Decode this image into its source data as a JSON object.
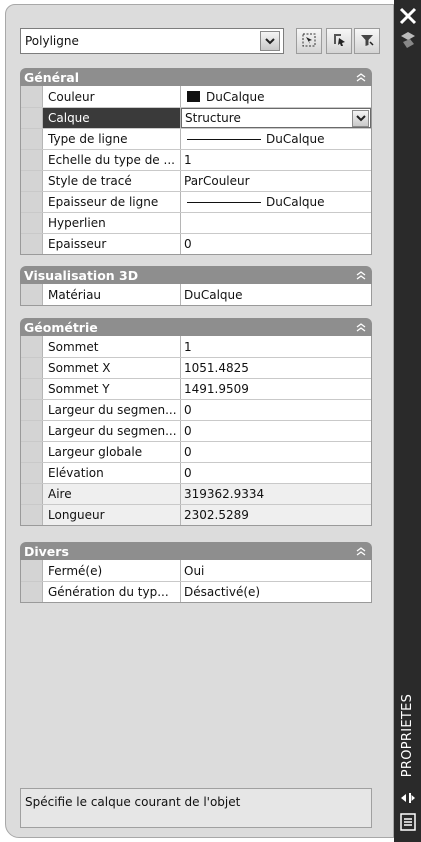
{
  "header": {
    "object_select": "Polyligne",
    "icons": [
      "select-objects-icon",
      "quick-select-icon",
      "pickadd-toggle-icon"
    ]
  },
  "sections": [
    {
      "title": "Général",
      "rows": [
        {
          "name": "Couleur",
          "value": "DuCalque",
          "kind": "swatch"
        },
        {
          "name": "Calque",
          "value": "Structure",
          "kind": "dropdown",
          "selected": true
        },
        {
          "name": "Type de ligne",
          "value": "DuCalque",
          "kind": "line"
        },
        {
          "name": "Echelle du type de ...",
          "value": "1"
        },
        {
          "name": "Style de tracé",
          "value": "ParCouleur"
        },
        {
          "name": "Epaisseur de ligne",
          "value": "DuCalque",
          "kind": "line"
        },
        {
          "name": "Hyperlien",
          "value": ""
        },
        {
          "name": "Epaisseur",
          "value": "0"
        }
      ]
    },
    {
      "title": "Visualisation 3D",
      "rows": [
        {
          "name": "Matériau",
          "value": "DuCalque"
        }
      ]
    },
    {
      "title": "Géométrie",
      "rows": [
        {
          "name": "Sommet",
          "value": "1"
        },
        {
          "name": "Sommet X",
          "value": "1051.4825"
        },
        {
          "name": "Sommet Y",
          "value": "1491.9509"
        },
        {
          "name": "Largeur du segmen...",
          "value": "0"
        },
        {
          "name": "Largeur du segmen...",
          "value": "0"
        },
        {
          "name": "Largeur globale",
          "value": "0"
        },
        {
          "name": "Elévation",
          "value": "0"
        },
        {
          "name": "Aire",
          "value": "319362.9334",
          "readonly": true
        },
        {
          "name": "Longueur",
          "value": "2302.5289",
          "readonly": true
        }
      ]
    },
    {
      "title": "Divers",
      "rows": [
        {
          "name": "Fermé(e)",
          "value": "Oui"
        },
        {
          "name": "Génération du typ...",
          "value": "Désactivé(e)"
        }
      ]
    }
  ],
  "description": "Spécifie le calque courant de l'objet",
  "palette_title": "PROPRIETES",
  "colors": {
    "header_bg": "#8e8e8e",
    "strip_bg": "#2a2a2a",
    "selected_row": "#3a3a3a"
  }
}
